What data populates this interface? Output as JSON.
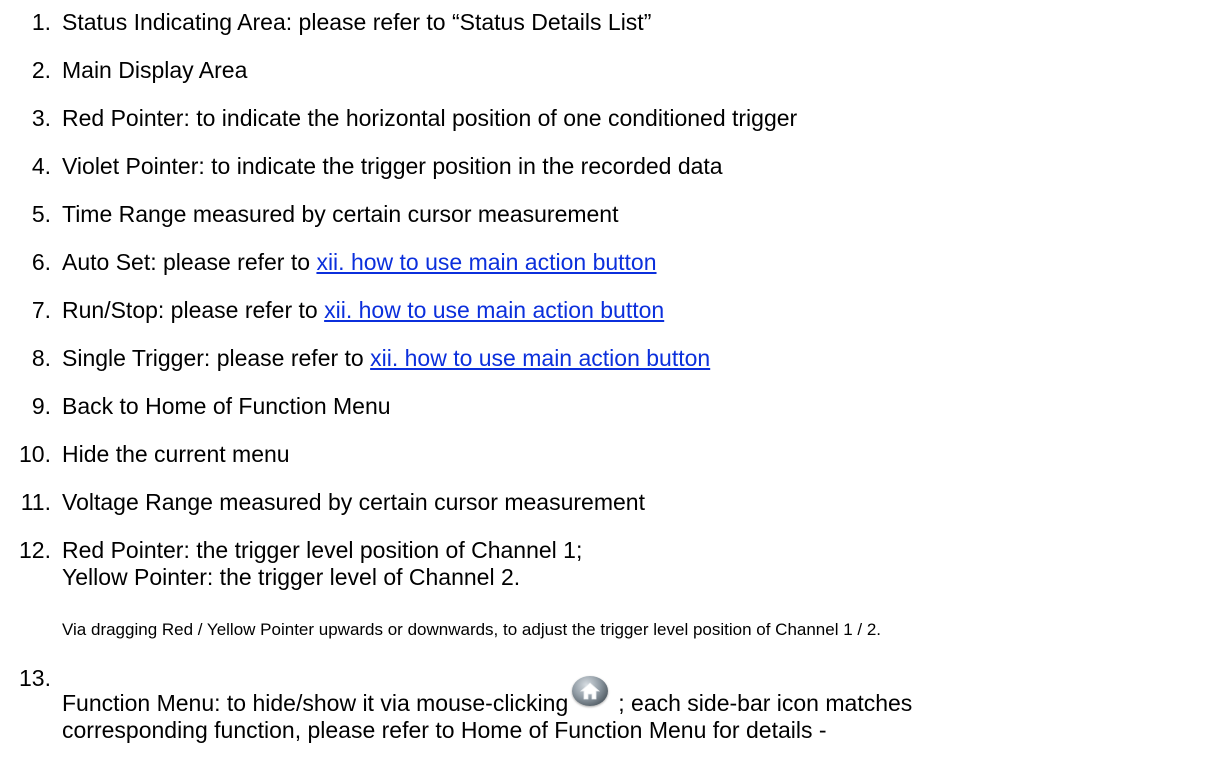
{
  "items": [
    {
      "number": "1.",
      "text": "Status Indicating Area: please refer to “Status Details List”"
    },
    {
      "number": "2.",
      "text": "Main Display Area"
    },
    {
      "number": "3.",
      "text": "Red Pointer: to indicate the horizontal position of one conditioned trigger"
    },
    {
      "number": "4.",
      "text": "Violet Pointer: to indicate the trigger position in the recorded data"
    },
    {
      "number": "5.",
      "text": "Time Range measured by certain cursor measurement"
    },
    {
      "number": "6.",
      "text": "Auto Set: please refer to ",
      "link": "xii. how to use main action button"
    },
    {
      "number": "7.",
      "text": "Run/Stop: please refer to ",
      "link": "xii. how to use main action button"
    },
    {
      "number": "8.",
      "text": "Single Trigger: please refer to ",
      "link": "xii. how to use main action button"
    },
    {
      "number": "9.",
      "text": "Back to Home of Function Menu"
    },
    {
      "number": "10.",
      "text": "Hide the current menu"
    },
    {
      "number": "11.",
      "text": "Voltage Range measured by certain cursor measurement"
    },
    {
      "number": "12.",
      "text": "Red Pointer: the trigger level position of Channel 1;",
      "text2": "Yellow Pointer: the trigger level of Channel 2."
    },
    {
      "number": "13."
    }
  ],
  "note_12": "Via dragging Red / Yellow Pointer upwards or downwards, to adjust the trigger level position of Channel 1 / 2.",
  "item_13": {
    "before_icon": "Function Menu: to hide/show it via mouse-clicking",
    "after_icon": "; each side-bar icon matches",
    "line2": "corresponding function, please refer to Home of Function Menu for details -",
    "icon": "home-icon"
  }
}
